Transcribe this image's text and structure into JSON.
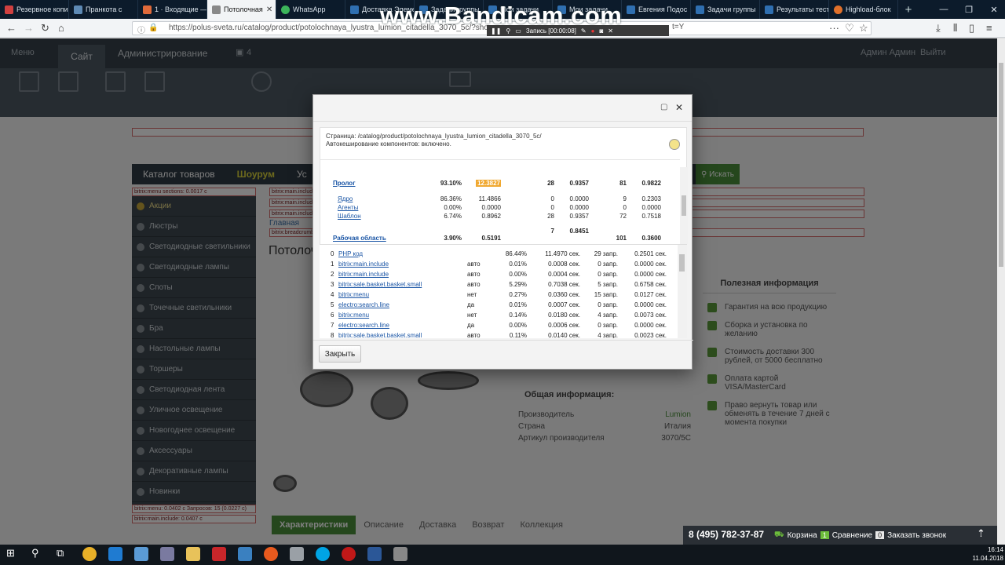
{
  "browser": {
    "tabs": [
      {
        "label": "Резервное копи",
        "active": false
      },
      {
        "label": "Пранкота с",
        "active": false
      },
      {
        "label": "1 · Входящие —",
        "active": false
      },
      {
        "label": "Потолочная",
        "active": true
      },
      {
        "label": "WhatsApp",
        "active": false
      },
      {
        "label": "Доставка Элемент",
        "active": false
      },
      {
        "label": "Задачи группы",
        "active": false
      },
      {
        "label": "Мои задачи",
        "active": false
      },
      {
        "label": "Мои задачи",
        "active": false
      },
      {
        "label": "Евгения Подос",
        "active": false
      },
      {
        "label": "Задачи группы",
        "active": false
      },
      {
        "label": "Результаты тест",
        "active": false
      },
      {
        "label": "Highload-блок",
        "active": false
      }
    ],
    "new_tab": "+",
    "url": "https://polus-sveta.ru/catalog/product/potolochnaya_lyustra_lumion_citadella_3070_5c/?show_page",
    "url_suffix": "t=Y"
  },
  "bandicam": {
    "watermark": "www.Bandicam.com",
    "recording": "Запись [00:00:08]"
  },
  "admin_panel": {
    "menu": "Меню",
    "site_tab": "Сайт",
    "admin_tab": "Администрирование",
    "counter": "4",
    "user": "Админ Админ",
    "exit": "Выйти"
  },
  "page": {
    "nav": [
      "Каталог товаров",
      "Шоурум",
      "Ус"
    ],
    "search_btn": "Искать",
    "sidebar": [
      "Акции",
      "Люстры",
      "Светодиодные светильники",
      "Светодиодные лампы",
      "Споты",
      "Точечные светильники",
      "Бра",
      "Настольные лампы",
      "Торшеры",
      "Светодиодная лента",
      "Уличное освещение",
      "Новогоднее освещение",
      "Аксессуары",
      "Декоративные лампы",
      "Новинки"
    ],
    "breadcrumb": "Главная",
    "title": "Потолочн",
    "useful_info_title": "Полезная информация",
    "useful_info": [
      "Гарантия на всю продукцию",
      "Сборка и установка по желанию",
      "Стоимость доставки 300 рублей, от 5000 бесплатно",
      "Оплата картой VISA/MasterCard",
      "Право вернуть товар или обменять в течение 7 дней с момента покупки"
    ],
    "general_info_title": "Общая информация:",
    "general_info": [
      {
        "label": "Производитель",
        "value": "Lumion"
      },
      {
        "label": "Страна",
        "value": "Италия"
      },
      {
        "label": "Артикул производителя",
        "value": "3070/5C"
      }
    ],
    "product_tabs": [
      "Характеристики",
      "Описание",
      "Доставка",
      "Возврат",
      "Коллекция"
    ],
    "debug_labels": [
      "bitrix:menu sections: 0.0017 с",
      "bitrix:main.include",
      "bitrix:main.include",
      "bitrix:main.include",
      "bitrix:breadcrumb",
      "bitrix:menu: 0.0402 с Запросов: 15 (0.0227 с)",
      "bitrix:main.include: 0.0407 с"
    ]
  },
  "dialog": {
    "page_path": "Страница: /catalog/product/potolochnaya_lyustra_lumion_citadella_3070_5c/",
    "cache_status": "Автокеширование компонентов: включено.",
    "summary": {
      "prolog": {
        "name": "Пролог",
        "pct": "93.10%",
        "time": "12.3827",
        "q1": "28",
        "t1": "0.9357",
        "q2": "81",
        "t2": "0.9822"
      },
      "sub": [
        {
          "name": "Ядро",
          "pct": "86.36%",
          "time": "11.4866",
          "q1": "0",
          "t1": "0.0000",
          "q2": "9",
          "t2": "0.2303"
        },
        {
          "name": "Агенты",
          "pct": "0.00%",
          "time": "0.0000",
          "q1": "0",
          "t1": "0.0000",
          "q2": "0",
          "t2": "0.0000"
        },
        {
          "name": "Шаблон",
          "pct": "6.74%",
          "time": "0.8962",
          "q1": "28",
          "t1": "0.9357",
          "q2": "72",
          "t2": "0.7518"
        }
      ],
      "mid": {
        "q1": "7",
        "t1": "0.8451"
      },
      "work": {
        "name": "Рабочая область",
        "pct": "3.90%",
        "time": "0.5191",
        "q2": "101",
        "t2": "0.3600"
      }
    },
    "components": [
      {
        "n": "0",
        "name": "PHP код",
        "cache": "",
        "pct": "86.44%",
        "time": "11.4970 сек.",
        "q": "29 запр.",
        "qt": "0.2501 сек."
      },
      {
        "n": "1",
        "name": "bitrix:main.include",
        "cache": "авто",
        "pct": "0.01%",
        "time": "0.0008 сек.",
        "q": "0 запр.",
        "qt": "0.0000 сек."
      },
      {
        "n": "2",
        "name": "bitrix:main.include",
        "cache": "авто",
        "pct": "0.00%",
        "time": "0.0004 сек.",
        "q": "0 запр.",
        "qt": "0.0000 сек."
      },
      {
        "n": "3",
        "name": "bitrix:sale.basket.basket.small",
        "cache": "авто",
        "pct": "5.29%",
        "time": "0.7038 сек.",
        "q": "5 запр.",
        "qt": "0.6758 сек."
      },
      {
        "n": "4",
        "name": "bitrix:menu",
        "cache": "нет",
        "pct": "0.27%",
        "time": "0.0360 сек.",
        "q": "15 запр.",
        "qt": "0.0127 сек."
      },
      {
        "n": "5",
        "name": "electro:search.line",
        "cache": "да",
        "pct": "0.01%",
        "time": "0.0007 сек.",
        "q": "0 запр.",
        "qt": "0.0000 сек."
      },
      {
        "n": "6",
        "name": "bitrix:menu",
        "cache": "нет",
        "pct": "0.14%",
        "time": "0.0180 сек.",
        "q": "4 запр.",
        "qt": "0.0073 сек."
      },
      {
        "n": "7",
        "name": "electro:search.line",
        "cache": "да",
        "pct": "0.00%",
        "time": "0.0006 сек.",
        "q": "0 запр.",
        "qt": "0.0000 сек."
      },
      {
        "n": "8",
        "name": "bitrix:sale.basket.basket.small",
        "cache": "авто",
        "pct": "0.11%",
        "time": "0.0140 сек.",
        "q": "4 запр.",
        "qt": "0.0023 сек."
      }
    ],
    "close_label": "Закрыть"
  },
  "bottom_bar": {
    "phone": "8 (495) 782-37-87",
    "cart": "Корзина",
    "cart_count": "1",
    "compare": "Сравнение",
    "compare_count": "0",
    "callback": "Заказать звонок"
  },
  "taskbar": {
    "time": "16:14",
    "date": "11.04.2018"
  },
  "colors": {
    "highlight": "#f0a830",
    "link": "#1a55a5",
    "green": "#4b8f3a"
  }
}
